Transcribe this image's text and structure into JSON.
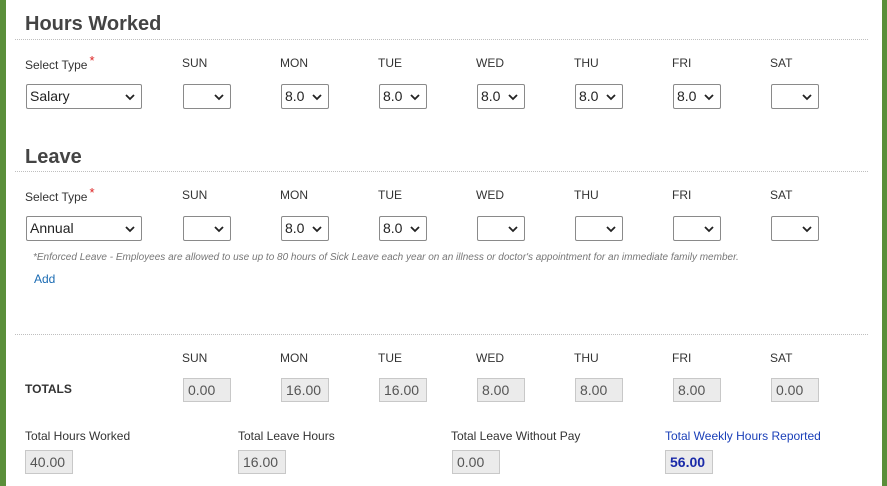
{
  "hours_worked": {
    "title": "Hours Worked",
    "select_type_label": "Select Type",
    "required_mark": "*",
    "type_value": "Salary",
    "days": [
      {
        "label": "SUN",
        "value": ""
      },
      {
        "label": "MON",
        "value": "8.0"
      },
      {
        "label": "TUE",
        "value": "8.0"
      },
      {
        "label": "WED",
        "value": "8.0"
      },
      {
        "label": "THU",
        "value": "8.0"
      },
      {
        "label": "FRI",
        "value": "8.0"
      },
      {
        "label": "SAT",
        "value": ""
      }
    ]
  },
  "leave": {
    "title": "Leave",
    "select_type_label": "Select Type",
    "required_mark": "*",
    "type_value": "Annual",
    "days": [
      {
        "label": "SUN",
        "value": ""
      },
      {
        "label": "MON",
        "value": "8.0"
      },
      {
        "label": "TUE",
        "value": "8.0"
      },
      {
        "label": "WED",
        "value": ""
      },
      {
        "label": "THU",
        "value": ""
      },
      {
        "label": "FRI",
        "value": ""
      },
      {
        "label": "SAT",
        "value": ""
      }
    ],
    "note": "*Enforced Leave - Employees are allowed to use up to 80 hours of Sick Leave each year on an illness or doctor's appointment for an immediate family member.",
    "add_label": "Add"
  },
  "totals": {
    "label": "TOTALS",
    "days": [
      {
        "label": "SUN",
        "value": "0.00"
      },
      {
        "label": "MON",
        "value": "16.00"
      },
      {
        "label": "TUE",
        "value": "16.00"
      },
      {
        "label": "WED",
        "value": "8.00"
      },
      {
        "label": "THU",
        "value": "8.00"
      },
      {
        "label": "FRI",
        "value": "8.00"
      },
      {
        "label": "SAT",
        "value": "0.00"
      }
    ]
  },
  "summary": {
    "total_hours_worked_label": "Total Hours Worked",
    "total_hours_worked": "40.00",
    "total_leave_hours_label": "Total Leave Hours",
    "total_leave_hours": "16.00",
    "total_leave_without_pay_label": "Total Leave Without Pay",
    "total_leave_without_pay": "0.00",
    "total_weekly_hours_label": "Total Weekly Hours Reported",
    "total_weekly_hours": "56.00"
  },
  "colors": {
    "frame": "#5a8f3a",
    "link": "#1a6bb3",
    "required": "#dd2222",
    "weekly_total": "#1a2aa8"
  }
}
